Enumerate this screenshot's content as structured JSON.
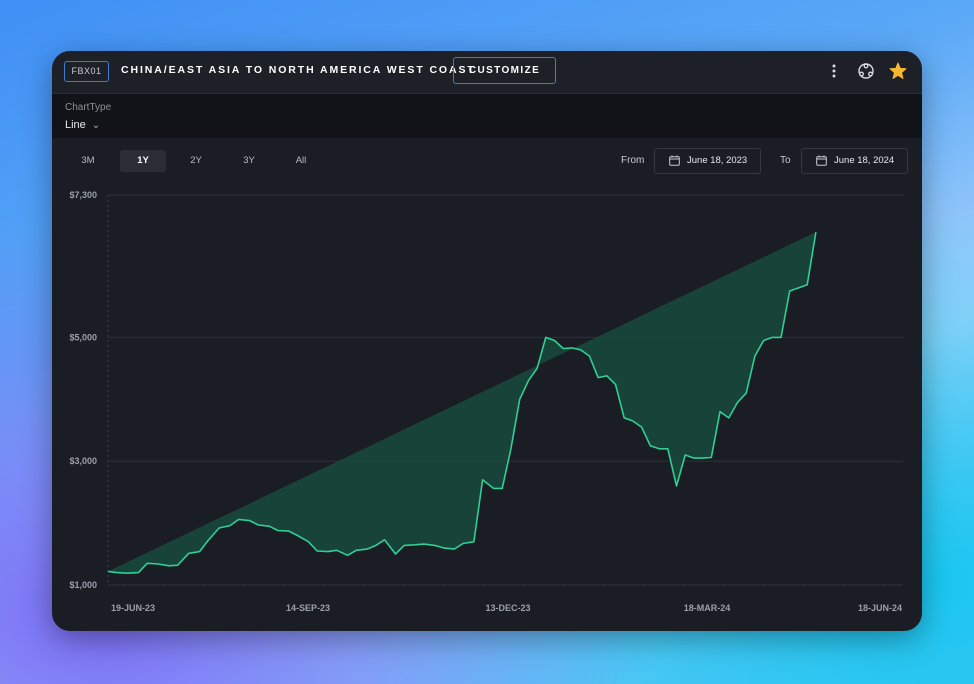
{
  "header": {
    "code": "FBX01",
    "title": "CHINA/EAST ASIA TO NORTH AMERICA WEST COAST",
    "customize_label": "CUSTOMIZE",
    "icons": [
      "more-vertical-icon",
      "share-network-icon",
      "star-icon"
    ],
    "star_color": "#f5b82e"
  },
  "controls": {
    "charttype_label": "ChartType",
    "charttype_value": "Line",
    "ranges": [
      "3M",
      "1Y",
      "2Y",
      "3Y",
      "All"
    ],
    "active_range": "1Y",
    "from_label": "From",
    "from_date": "June 18, 2023",
    "to_label": "To",
    "to_date": "June 18, 2024"
  },
  "chart_data": {
    "type": "area",
    "title": "",
    "xlabel": "",
    "ylabel": "",
    "line_color": "#2fcf96",
    "fill_color": "#184a3c",
    "ylim": [
      1000,
      7300
    ],
    "y_ticks": [
      "$7,300",
      "$5,000",
      "$3,000",
      "$1,000"
    ],
    "y_tick_values": [
      7300,
      5000,
      3000,
      1000
    ],
    "x_ticks": [
      "19-JUN-23",
      "14-SEP-23",
      "13-DEC-23",
      "18-MAR-24",
      "18-JUN-24"
    ],
    "x_range": [
      "2023-06-19",
      "2024-06-18"
    ],
    "x": [
      "2023-06-19",
      "2023-06-23",
      "2023-06-28",
      "2023-07-03",
      "2023-07-07",
      "2023-07-12",
      "2023-07-17",
      "2023-07-21",
      "2023-07-26",
      "2023-07-31",
      "2023-08-04",
      "2023-08-09",
      "2023-08-14",
      "2023-08-18",
      "2023-08-23",
      "2023-08-27",
      "2023-09-01",
      "2023-09-05",
      "2023-09-10",
      "2023-09-14",
      "2023-09-19",
      "2023-09-23",
      "2023-09-28",
      "2023-10-02",
      "2023-10-07",
      "2023-10-11",
      "2023-10-16",
      "2023-10-20",
      "2023-10-24",
      "2023-10-29",
      "2023-11-02",
      "2023-11-07",
      "2023-11-11",
      "2023-11-16",
      "2023-11-20",
      "2023-11-25",
      "2023-11-29",
      "2023-12-04",
      "2023-12-08",
      "2023-12-13",
      "2023-12-17",
      "2023-12-21",
      "2023-12-25",
      "2023-12-29",
      "2024-01-02",
      "2024-01-06",
      "2024-01-10",
      "2024-01-14",
      "2024-01-18",
      "2024-01-22",
      "2024-01-26",
      "2024-01-30",
      "2024-02-03",
      "2024-02-07",
      "2024-02-11",
      "2024-02-15",
      "2024-02-19",
      "2024-02-23",
      "2024-02-27",
      "2024-03-02",
      "2024-03-06",
      "2024-03-10",
      "2024-03-14",
      "2024-03-18",
      "2024-03-22",
      "2024-03-26",
      "2024-03-30",
      "2024-04-03",
      "2024-04-07",
      "2024-04-11",
      "2024-04-15",
      "2024-04-19",
      "2024-04-23",
      "2024-04-27",
      "2024-05-01",
      "2024-05-05",
      "2024-05-09",
      "2024-05-13",
      "2024-05-17",
      "2024-05-21",
      "2024-05-25",
      "2024-05-29",
      "2024-06-02",
      "2024-06-06",
      "2024-06-10",
      "2024-06-14",
      "2024-06-18"
    ],
    "series": [
      {
        "values": [
          1220,
          1200,
          1190,
          1200,
          1350,
          1340,
          1310,
          1320,
          1510,
          1540,
          1720,
          1920,
          1960,
          2060,
          2040,
          1970,
          1950,
          1880,
          1870,
          1800,
          1700,
          1550,
          1540,
          1560,
          1480,
          1560,
          1580,
          1640,
          1730,
          1500,
          1640,
          1650,
          1660,
          1640,
          1600,
          1580,
          1670,
          1700,
          2700,
          2560,
          2560,
          3200,
          4000,
          4300,
          4500,
          5000,
          4950,
          4820,
          4830,
          4800,
          4700,
          4350,
          4380,
          4240,
          3700,
          3650,
          3550,
          3250,
          3200,
          3200,
          2600,
          3100,
          3050,
          3050,
          3060,
          3800,
          3700,
          3950,
          4100,
          4700,
          4950,
          5000,
          5000,
          5750,
          5800,
          5850,
          6700
        ]
      }
    ]
  }
}
